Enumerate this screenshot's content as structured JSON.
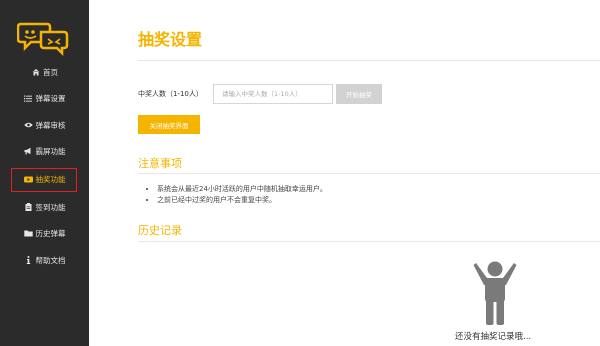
{
  "sidebar": {
    "items": [
      {
        "label": "首页",
        "icon": "home-icon"
      },
      {
        "label": "弹幕设置",
        "icon": "list-icon"
      },
      {
        "label": "弹幕审核",
        "icon": "eye-icon"
      },
      {
        "label": "霸屏功能",
        "icon": "megaphone-icon"
      },
      {
        "label": "抽奖功能",
        "icon": "video-icon",
        "active": true
      },
      {
        "label": "签到功能",
        "icon": "clipboard-icon"
      },
      {
        "label": "历史弹幕",
        "icon": "folder-icon"
      },
      {
        "label": "帮助文档",
        "icon": "info-icon"
      }
    ]
  },
  "main": {
    "title": "抽奖设置",
    "form": {
      "label": "中奖人数（1-10人）",
      "placeholder": "请输入中奖人数（1-10人）",
      "start_button": "开始抽奖",
      "close_button": "关闭抽奖界面"
    },
    "notes": {
      "title": "注意事项",
      "items": [
        "系统会从最近24小时活跃的用户中随机抽取幸运用户。",
        "之前已经中过奖的用户不会重复中奖。"
      ]
    },
    "history": {
      "title": "历史记录",
      "empty_text": "还没有抽奖记录哦..."
    }
  },
  "colors": {
    "accent": "#f5b400",
    "sidebar_bg": "#2b2b2b",
    "active_outline": "#e02020",
    "disabled_button": "#d2d2d2",
    "figure": "#7a7a7a"
  }
}
